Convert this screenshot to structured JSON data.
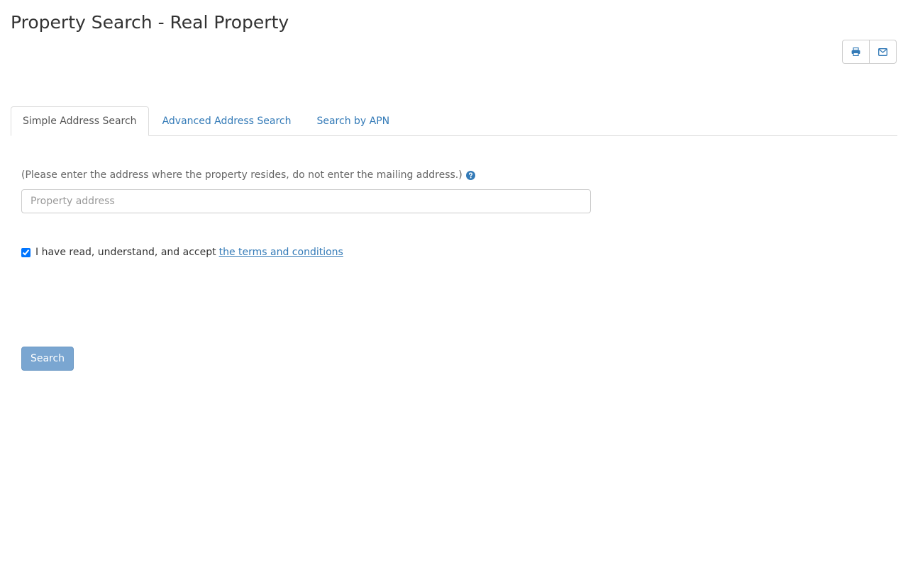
{
  "header": {
    "title": "Property Search - Real Property"
  },
  "actions": {
    "print_icon": "print-icon",
    "email_icon": "envelope-icon"
  },
  "tabs": [
    {
      "label": "Simple Address Search",
      "active": true
    },
    {
      "label": "Advanced Address Search",
      "active": false
    },
    {
      "label": "Search by APN",
      "active": false
    }
  ],
  "form": {
    "hint": "(Please enter the address where the property resides, do not enter the mailing address.)",
    "help_icon": "question-circle-icon",
    "address_placeholder": "Property address",
    "address_value": "",
    "terms_checked": true,
    "terms_text": "I have read, understand, and accept",
    "terms_link": "the terms and conditions",
    "search_label": "Search"
  },
  "colors": {
    "link": "#337ab7",
    "search_button": "#7aa6d1"
  }
}
